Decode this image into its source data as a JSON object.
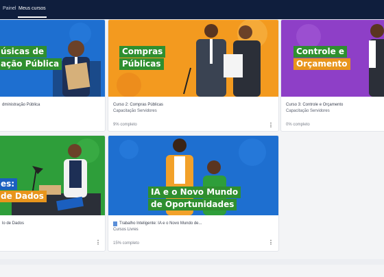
{
  "nav": {
    "items": [
      "Painel",
      "Meus cursos"
    ]
  },
  "cards": [
    {
      "banner": [
        "úsicas de",
        "ação Pública"
      ],
      "title": "dministração Pública",
      "subtitle": "",
      "progress": "",
      "menu": "⋮"
    },
    {
      "banner": [
        "Compras",
        "Públicas"
      ],
      "title": "Curso 2: Compras Públicas",
      "subtitle": "Capacitação Servidores",
      "progress": "9% completo",
      "menu": "⋮"
    },
    {
      "banner": [
        "Controle e",
        "Orçamento"
      ],
      "title": "Curso 3: Controle e Orçamento",
      "subtitle": "Capacitação Servidores",
      "progress": "0% completo",
      "menu": "⋮"
    },
    {
      "banner": [
        "es:",
        "de Dados"
      ],
      "title": "lo de Dados",
      "subtitle": "",
      "progress": "",
      "menu": "⋮"
    },
    {
      "banner": [
        "IA e o Novo Mundo",
        "de Oportunidades"
      ],
      "title": "Trabalho Inteligente: IA e o Novo Mundo de...",
      "subtitle": "Cursos Livres",
      "progress": "15% completo",
      "menu": "⋮"
    }
  ],
  "colors": {
    "nav_bg": "#0f1e3d",
    "banner_blue": "#1e6fd0",
    "banner_orange": "#f39a1f",
    "banner_purple": "#8e3fc7",
    "banner_green": "#2e9e3a",
    "label_green": "#2f8f2f",
    "label_orange": "#e8951c",
    "label_blue": "#1b5fbf"
  },
  "icons": [
    "vertical-dots-icon",
    "document-icon"
  ]
}
